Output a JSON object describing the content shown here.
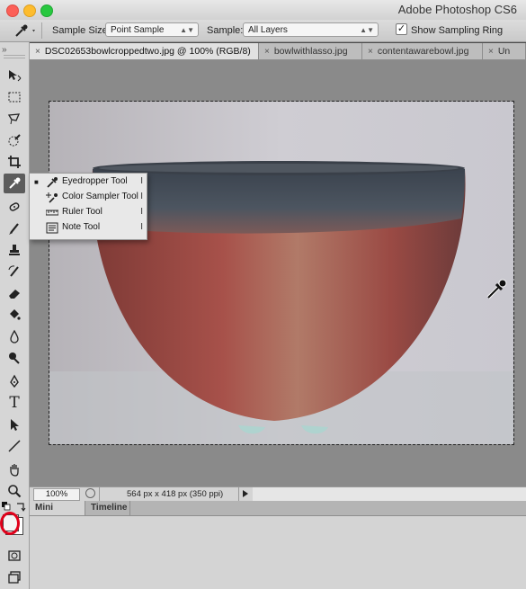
{
  "app": {
    "title": "Adobe Photoshop CS6"
  },
  "options_bar": {
    "sample_size_label": "Sample Size:",
    "sample_size_value": "Point Sample",
    "sample_label": "Sample:",
    "sample_value": "All Layers",
    "show_sampling_ring_label": "Show Sampling Ring",
    "show_sampling_ring_checked": "✓"
  },
  "tabs": [
    {
      "label": "DSC02653bowlcroppedtwo.jpg @ 100% (RGB/8)",
      "close": "×",
      "active": true
    },
    {
      "label": "bowlwithlasso.jpg",
      "close": "×"
    },
    {
      "label": "contentawarebowl.jpg",
      "close": "×"
    },
    {
      "label": "Un",
      "close": "×"
    }
  ],
  "toolbar": {
    "collapse": "»",
    "tools": [
      "move-tool",
      "marquee-tool",
      "lasso-tool",
      "quick-selection-tool",
      "crop-tool",
      "eyedropper-tool",
      "spot-healing-tool",
      "brush-tool",
      "clone-stamp-tool",
      "history-brush-tool",
      "eraser-tool",
      "paint-bucket-tool",
      "blur-tool",
      "dodge-tool",
      "pen-tool",
      "type-tool",
      "path-selection-tool",
      "line-tool",
      "hand-tool",
      "zoom-tool"
    ],
    "type_glyph": "T"
  },
  "flyout_menu": {
    "items": [
      {
        "label": "Eyedropper Tool",
        "shortcut": "I",
        "selected": "■"
      },
      {
        "label": "Color Sampler Tool",
        "shortcut": "I"
      },
      {
        "label": "Ruler Tool",
        "shortcut": "I"
      },
      {
        "label": "Note Tool",
        "shortcut": "I"
      }
    ]
  },
  "status_bar": {
    "zoom": "100%",
    "doc_info": "564 px x 418 px (350 ppi)"
  },
  "panel": {
    "tabs": [
      "Mini Bridge",
      "Timeline"
    ]
  },
  "colors": {
    "highlight_circle": "#e0001a",
    "bowl_red": "#a24a42",
    "bowl_dark": "#3d4650"
  }
}
